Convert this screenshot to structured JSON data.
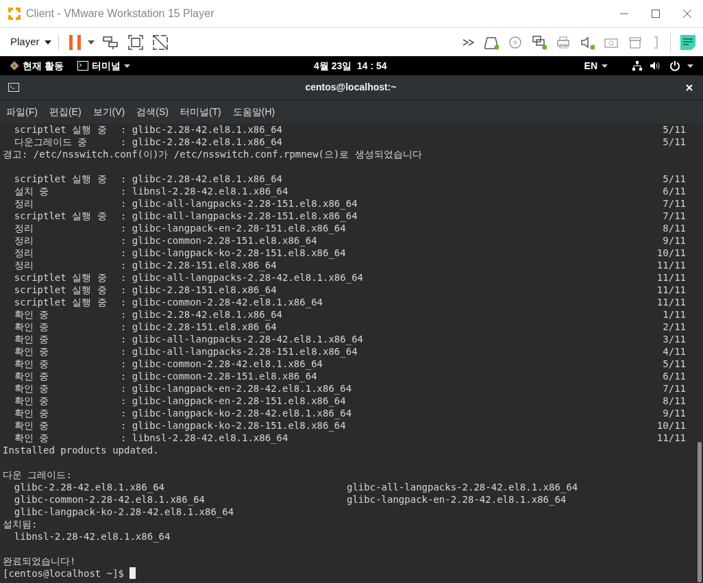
{
  "window": {
    "title": "Client - VMware Workstation 15 Player"
  },
  "toolbar": {
    "player_menu": "Player"
  },
  "gnome_bar": {
    "activities": "현재 활동",
    "app_menu": "터미널",
    "clock": "4월 23일  14 : 54",
    "input_source": "EN"
  },
  "terminal": {
    "title": "centos@localhost:~",
    "menu": [
      "파일(F)",
      "편집(E)",
      "보기(V)",
      "검색(S)",
      "터미널(T)",
      "도움말(H)"
    ],
    "lines": [
      {
        "kind": "entry",
        "label": "  scriptlet 실행 중",
        "package": ": glibc-2.28-42.el8.1.x86_64",
        "count": "5/11"
      },
      {
        "kind": "entry",
        "label": "  다운그레이드 중  ",
        "package": ": glibc-2.28-42.el8.1.x86_64",
        "count": "5/11"
      },
      {
        "kind": "text",
        "text": "경고: /etc/nsswitch.conf(이)가 /etc/nsswitch.conf.rpmnew(으)로 생성되었습니다"
      },
      {
        "kind": "blank"
      },
      {
        "kind": "entry",
        "label": "  scriptlet 실행 중",
        "package": ": glibc-2.28-42.el8.1.x86_64",
        "count": "5/11"
      },
      {
        "kind": "entry",
        "label": "  설치 중",
        "package": ": libnsl-2.28-42.el8.1.x86_64",
        "count": "6/11"
      },
      {
        "kind": "entry",
        "label": "  정리",
        "package": ": glibc-all-langpacks-2.28-151.el8.x86_64",
        "count": "7/11"
      },
      {
        "kind": "entry",
        "label": "  scriptlet 실행 중",
        "package": ": glibc-all-langpacks-2.28-151.el8.x86_64",
        "count": "7/11"
      },
      {
        "kind": "entry",
        "label": "  정리",
        "package": ": glibc-langpack-en-2.28-151.el8.x86_64",
        "count": "8/11"
      },
      {
        "kind": "entry",
        "label": "  정리",
        "package": ": glibc-common-2.28-151.el8.x86_64",
        "count": "9/11"
      },
      {
        "kind": "entry",
        "label": "  정리",
        "package": ": glibc-langpack-ko-2.28-151.el8.x86_64",
        "count": "10/11"
      },
      {
        "kind": "entry",
        "label": "  정리",
        "package": ": glibc-2.28-151.el8.x86_64",
        "count": "11/11"
      },
      {
        "kind": "entry",
        "label": "  scriptlet 실행 중",
        "package": ": glibc-all-langpacks-2.28-42.el8.1.x86_64",
        "count": "11/11"
      },
      {
        "kind": "entry",
        "label": "  scriptlet 실행 중",
        "package": ": glibc-2.28-151.el8.x86_64",
        "count": "11/11"
      },
      {
        "kind": "entry",
        "label": "  scriptlet 실행 중",
        "package": ": glibc-common-2.28-42.el8.1.x86_64",
        "count": "11/11"
      },
      {
        "kind": "entry",
        "label": "  확인 중",
        "package": ": glibc-2.28-42.el8.1.x86_64",
        "count": "1/11"
      },
      {
        "kind": "entry",
        "label": "  확인 중",
        "package": ": glibc-2.28-151.el8.x86_64",
        "count": "2/11"
      },
      {
        "kind": "entry",
        "label": "  확인 중",
        "package": ": glibc-all-langpacks-2.28-42.el8.1.x86_64",
        "count": "3/11"
      },
      {
        "kind": "entry",
        "label": "  확인 중",
        "package": ": glibc-all-langpacks-2.28-151.el8.x86_64",
        "count": "4/11"
      },
      {
        "kind": "entry",
        "label": "  확인 중",
        "package": ": glibc-common-2.28-42.el8.1.x86_64",
        "count": "5/11"
      },
      {
        "kind": "entry",
        "label": "  확인 중",
        "package": ": glibc-common-2.28-151.el8.x86_64",
        "count": "6/11"
      },
      {
        "kind": "entry",
        "label": "  확인 중",
        "package": ": glibc-langpack-en-2.28-42.el8.1.x86_64",
        "count": "7/11"
      },
      {
        "kind": "entry",
        "label": "  확인 중",
        "package": ": glibc-langpack-en-2.28-151.el8.x86_64",
        "count": "8/11"
      },
      {
        "kind": "entry",
        "label": "  확인 중",
        "package": ": glibc-langpack-ko-2.28-42.el8.1.x86_64",
        "count": "9/11"
      },
      {
        "kind": "entry",
        "label": "  확인 중",
        "package": ": glibc-langpack-ko-2.28-151.el8.x86_64",
        "count": "10/11"
      },
      {
        "kind": "entry",
        "label": "  확인 중",
        "package": ": libnsl-2.28-42.el8.1.x86_64",
        "count": "11/11"
      },
      {
        "kind": "text",
        "text": "Installed products updated."
      },
      {
        "kind": "blank"
      },
      {
        "kind": "text",
        "text": "다운 그레이드:"
      },
      {
        "kind": "columns",
        "items": [
          "  glibc-2.28-42.el8.1.x86_64",
          "glibc-all-langpacks-2.28-42.el8.1.x86_64"
        ]
      },
      {
        "kind": "columns",
        "items": [
          "  glibc-common-2.28-42.el8.1.x86_64",
          "glibc-langpack-en-2.28-42.el8.1.x86_64"
        ]
      },
      {
        "kind": "columns",
        "items": [
          "  glibc-langpack-ko-2.28-42.el8.1.x86_64"
        ]
      },
      {
        "kind": "text",
        "text": "설치됨:"
      },
      {
        "kind": "text",
        "text": "  libnsl-2.28-42.el8.1.x86_64"
      },
      {
        "kind": "blank"
      },
      {
        "kind": "text",
        "text": "완료되었습니다!"
      },
      {
        "kind": "prompt",
        "text": "[centos@localhost ~]$ "
      }
    ]
  }
}
